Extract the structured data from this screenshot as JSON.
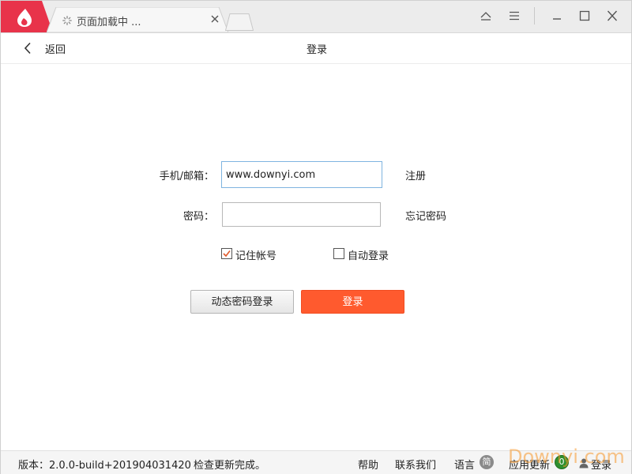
{
  "titlebar": {
    "tab_title": "页面加载中 ...",
    "icons": {
      "logo": "flame-logo-icon",
      "tab_loading": "loading-spinner-icon",
      "tab_close": "close-icon",
      "new_tab": "new-tab-icon",
      "skin": "skin-icon",
      "menu": "menu-icon",
      "minimize": "minimize-icon",
      "maximize": "maximize-icon",
      "close": "close-icon"
    }
  },
  "nav": {
    "back_label": "返回",
    "page_title": "登录"
  },
  "form": {
    "account_label": "手机/邮箱：",
    "account_value": "www.downyi.com",
    "password_label": "密码：",
    "password_value": "",
    "register_link": "注册",
    "forgot_link": "忘记密码",
    "remember_label": "记住帐号",
    "remember_checked": true,
    "auto_login_label": "自动登录",
    "auto_login_checked": false,
    "dynamic_login_button": "动态密码登录",
    "login_button": "登录"
  },
  "status": {
    "version": "版本：2.0.0-build+201904031420",
    "check_message": "检查更新完成。",
    "help": "帮助",
    "contact": "联系我们",
    "language": "语言",
    "language_badge": "简",
    "update": "应用更新",
    "update_badge": "0",
    "login": "登录",
    "watermark": "Downyi.com"
  },
  "colors": {
    "brand_red": "#e8334a",
    "primary_button": "#ff5a2e",
    "checkmark": "#e05a2b",
    "focus_border": "#7fb4e0",
    "update_badge": "#2f8f2f"
  }
}
